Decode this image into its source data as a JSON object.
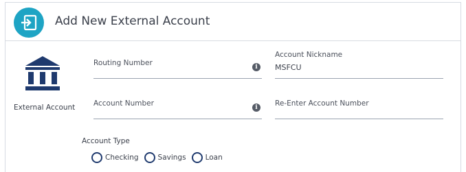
{
  "header": {
    "title": "Add New External Account",
    "icon": "sign-in-arrow-icon",
    "icon_bg_color": "#1ea4c4"
  },
  "side": {
    "icon": "bank-icon",
    "icon_color": "#1f3a6e",
    "label": "External Account"
  },
  "fields": {
    "routing_number": {
      "label": "Routing Number",
      "value": "",
      "info_icon": "info-icon"
    },
    "account_nickname": {
      "label": "Account Nickname",
      "value": "MSFCU"
    },
    "account_number": {
      "label": "Account Number",
      "value": "",
      "info_icon": "info-icon"
    },
    "reenter_account_number": {
      "label": "Re-Enter Account Number",
      "value": ""
    }
  },
  "account_type": {
    "label": "Account Type",
    "options": [
      "Checking",
      "Savings",
      "Loan"
    ],
    "selected": null
  },
  "colors": {
    "radio_border": "#1f3a6e",
    "input_underline": "#9aa3b0"
  }
}
